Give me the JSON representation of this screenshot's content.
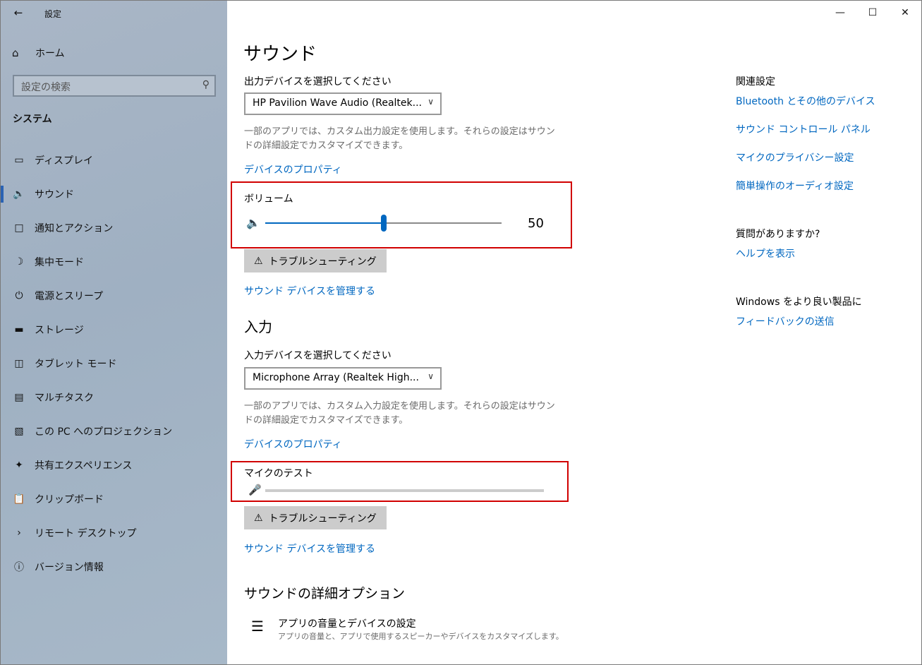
{
  "window": {
    "title": "設定"
  },
  "sidebar": {
    "home_label": "ホーム",
    "search_placeholder": "設定の検索",
    "section": "システム",
    "items": [
      {
        "label": "ディスプレイ",
        "icon": "display-icon"
      },
      {
        "label": "サウンド",
        "icon": "speaker-icon"
      },
      {
        "label": "通知とアクション",
        "icon": "notification-icon"
      },
      {
        "label": "集中モード",
        "icon": "moon-icon"
      },
      {
        "label": "電源とスリープ",
        "icon": "power-icon"
      },
      {
        "label": "ストレージ",
        "icon": "storage-icon"
      },
      {
        "label": "タブレット モード",
        "icon": "tablet-icon"
      },
      {
        "label": "マルチタスク",
        "icon": "multitask-icon"
      },
      {
        "label": "この PC へのプロジェクション",
        "icon": "projection-icon"
      },
      {
        "label": "共有エクスペリエンス",
        "icon": "shared-icon"
      },
      {
        "label": "クリップボード",
        "icon": "clipboard-icon"
      },
      {
        "label": "リモート デスクトップ",
        "icon": "remote-icon"
      },
      {
        "label": "バージョン情報",
        "icon": "info-icon"
      }
    ],
    "active_item": "サウンド"
  },
  "main": {
    "title": "サウンド",
    "output": {
      "label": "出力デバイスを選択してください",
      "device": "HP Pavilion Wave Audio (Realtek...",
      "desc": "一部のアプリでは、カスタム出力設定を使用します。それらの設定はサウンドの詳細設定でカスタマイズできます。",
      "properties_link": "デバイスのプロパティ",
      "volume_label": "ボリューム",
      "volume_value": "50",
      "volume_fraction": 0.5,
      "troubleshoot": "トラブルシューティング",
      "manage_link": "サウンド デバイスを管理する"
    },
    "input": {
      "heading": "入力",
      "label": "入力デバイスを選択してください",
      "device": "Microphone Array (Realtek High...",
      "desc": "一部のアプリでは、カスタム入力設定を使用します。それらの設定はサウンドの詳細設定でカスタマイズできます。",
      "properties_link": "デバイスのプロパティ",
      "mic_test_label": "マイクのテスト",
      "mic_level": 0,
      "troubleshoot": "トラブルシューティング",
      "manage_link": "サウンド デバイスを管理する"
    },
    "advanced": {
      "heading": "サウンドの詳細オプション",
      "item_title": "アプリの音量とデバイスの設定",
      "item_desc": "アプリの音量と、アプリで使用するスピーカーやデバイスをカスタマイズします。"
    }
  },
  "related": {
    "title": "関連設定",
    "links": [
      "Bluetooth とその他のデバイス",
      "サウンド コントロール パネル",
      "マイクのプライバシー設定",
      "簡単操作のオーディオ設定"
    ],
    "question": "質問がありますか?",
    "help_link": "ヘルプを表示",
    "feedback_title": "Windows をより良い製品に",
    "feedback_link": "フィードバックの送信"
  },
  "colors": {
    "accent": "#0067c0",
    "highlight_border": "#d10000",
    "sidebar_bg": "#a9b6c6"
  }
}
